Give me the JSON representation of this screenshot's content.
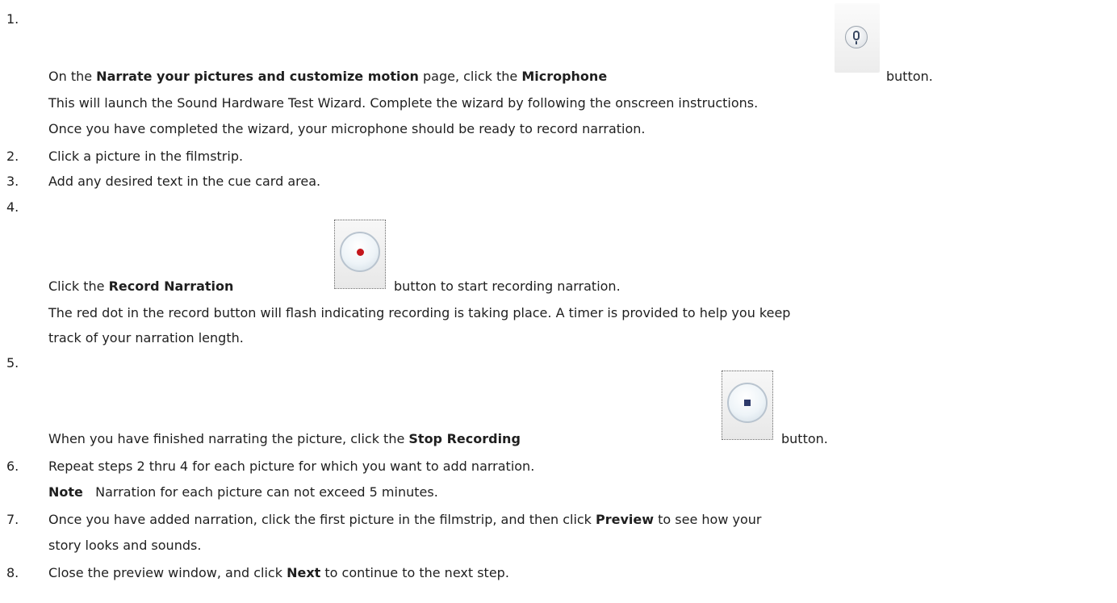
{
  "steps": {
    "s1": {
      "num": "1.",
      "line1_pre": "On the ",
      "line1_b1": "Narrate your pictures and customize motion",
      "line1_mid": " page, click the ",
      "line1_b2": "Microphone",
      "line1_post": "button.",
      "line2": "This will launch the Sound Hardware Test Wizard. Complete the wizard by following the onscreen instructions.",
      "line3": "Once you have completed the wizard, your microphone should be ready to record narration."
    },
    "s2": {
      "num": "2.",
      "text": "Click a picture in the filmstrip."
    },
    "s3": {
      "num": "3.",
      "text": "Add any desired text in the cue card area."
    },
    "s4": {
      "num": "4.",
      "line1_pre": "Click the ",
      "line1_b": "Record Narration",
      "line1_post": "button to start recording narration.",
      "line2": "The red dot in the record button will flash indicating recording is taking place. A timer is provided to help you keep",
      "line3": "track of your narration length."
    },
    "s5": {
      "num": "5.",
      "line1_pre": "When you have finished narrating the picture, click the ",
      "line1_b": "Stop Recording",
      "line1_post": "button."
    },
    "s6": {
      "num": "6.",
      "text": "Repeat steps 2 thru 4 for each picture for which you want to add narration.",
      "note_label": "Note",
      "note_text": "Narration for each picture can not exceed 5 minutes."
    },
    "s7": {
      "num": "7.",
      "line1_pre": "Once you have added narration, click the first picture in the filmstrip, and then click ",
      "line1_b": "Preview",
      "line1_post": " to see how your",
      "line2": "story looks and sounds."
    },
    "s8": {
      "num": "8.",
      "pre": "Close the preview window, and click ",
      "b": "Next",
      "post": " to continue to the next step."
    }
  },
  "icons": {
    "microphone": "microphone-icon",
    "record": "record-narration-icon",
    "stop": "stop-recording-icon",
    "record_dot_color": "#c4161c",
    "stop_square_color": "#2d3a6b"
  }
}
